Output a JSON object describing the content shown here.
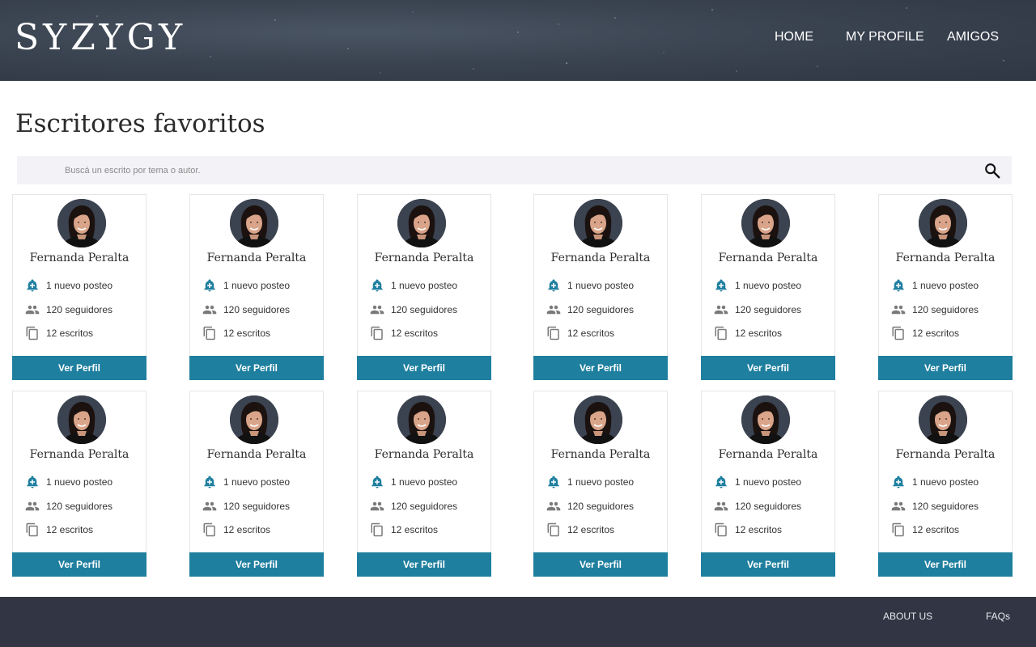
{
  "header": {
    "logo": "SYZYGY",
    "nav": [
      {
        "label": "HOME"
      },
      {
        "label": "MY PROFILE"
      },
      {
        "label": "AMIGOS"
      }
    ]
  },
  "page_title": "Escritores favoritos",
  "search": {
    "placeholder": "Buscá un escrito por tema o autor."
  },
  "cards": [
    {
      "name": "Fernanda Peralta",
      "posts": "1 nuevo posteo",
      "followers": "120 seguidores",
      "writings": "12 escritos",
      "button": "Ver Perfil"
    },
    {
      "name": "Fernanda Peralta",
      "posts": "1 nuevo posteo",
      "followers": "120 seguidores",
      "writings": "12 escritos",
      "button": "Ver Perfil"
    },
    {
      "name": "Fernanda Peralta",
      "posts": "1 nuevo posteo",
      "followers": "120 seguidores",
      "writings": "12 escritos",
      "button": "Ver Perfil"
    },
    {
      "name": "Fernanda Peralta",
      "posts": "1 nuevo posteo",
      "followers": "120 seguidores",
      "writings": "12 escritos",
      "button": "Ver Perfil"
    },
    {
      "name": "Fernanda Peralta",
      "posts": "1 nuevo posteo",
      "followers": "120 seguidores",
      "writings": "12 escritos",
      "button": "Ver Perfil"
    },
    {
      "name": "Fernanda Peralta",
      "posts": "1 nuevo posteo",
      "followers": "120 seguidores",
      "writings": "12 escritos",
      "button": "Ver Perfil"
    },
    {
      "name": "Fernanda Peralta",
      "posts": "1 nuevo posteo",
      "followers": "120 seguidores",
      "writings": "12 escritos",
      "button": "Ver Perfil"
    },
    {
      "name": "Fernanda Peralta",
      "posts": "1 nuevo posteo",
      "followers": "120 seguidores",
      "writings": "12 escritos",
      "button": "Ver Perfil"
    },
    {
      "name": "Fernanda Peralta",
      "posts": "1 nuevo posteo",
      "followers": "120 seguidores",
      "writings": "12 escritos",
      "button": "Ver Perfil"
    },
    {
      "name": "Fernanda Peralta",
      "posts": "1 nuevo posteo",
      "followers": "120 seguidores",
      "writings": "12 escritos",
      "button": "Ver Perfil"
    },
    {
      "name": "Fernanda Peralta",
      "posts": "1 nuevo posteo",
      "followers": "120 seguidores",
      "writings": "12 escritos",
      "button": "Ver Perfil"
    },
    {
      "name": "Fernanda Peralta",
      "posts": "1 nuevo posteo",
      "followers": "120 seguidores",
      "writings": "12 escritos",
      "button": "Ver Perfil"
    }
  ],
  "footer": {
    "links": [
      {
        "label": "ABOUT US"
      },
      {
        "label": "FAQs"
      }
    ]
  },
  "colors": {
    "header_bg": "#3a4350",
    "accent_button": "#1f7f9f",
    "icon_teal": "#1f7f9f",
    "icon_gray": "#7a7a7a",
    "footer_bg": "#323644",
    "search_bg": "#f3f3f7"
  },
  "icons": {
    "posts": "bell-plus-icon",
    "followers": "people-icon",
    "writings": "copy-documents-icon",
    "search": "search-icon"
  }
}
